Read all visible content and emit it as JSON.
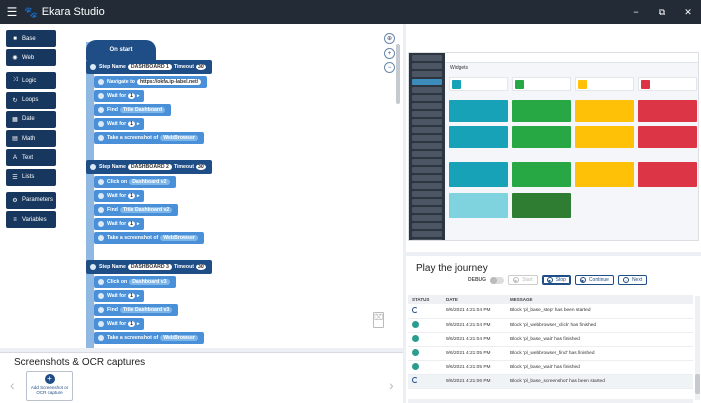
{
  "app": {
    "title": "Ekara Studio",
    "menu_icon": "hamburger-icon",
    "logo_icon": "paw-icon",
    "window_controls": [
      "−",
      "⧉",
      "✕"
    ]
  },
  "palette": {
    "items": [
      {
        "label": "Base",
        "icon": "briefcase-icon",
        "glyph": "■"
      },
      {
        "label": "Web",
        "icon": "globe-icon",
        "glyph": "◉"
      },
      {
        "label": "Logic",
        "icon": "shuffle-icon",
        "glyph": "⤨"
      },
      {
        "label": "Loops",
        "icon": "loop-icon",
        "glyph": "↻"
      },
      {
        "label": "Date",
        "icon": "calendar-icon",
        "glyph": "▦"
      },
      {
        "label": "Math",
        "icon": "calculator-icon",
        "glyph": "▤"
      },
      {
        "label": "Text",
        "icon": "text-icon",
        "glyph": "A"
      },
      {
        "label": "Lists",
        "icon": "list-icon",
        "glyph": "☰"
      },
      {
        "label": "Parameters",
        "icon": "sliders-icon",
        "glyph": "⚙"
      },
      {
        "label": "Variables",
        "icon": "variables-icon",
        "glyph": "≡"
      }
    ]
  },
  "blocks": {
    "on_start": "On start",
    "steps": [
      {
        "step": "Step",
        "name_label": "Name",
        "name": "DASHBOARD 1",
        "timeout_label": "Timeout",
        "timeout": "30",
        "subs": [
          {
            "pre": "Navigate to",
            "val": "https://okfa.ip-label.net/"
          },
          {
            "pre": "Wait for",
            "val": "1"
          },
          {
            "pre": "Find",
            "val": "Title Dashboard"
          },
          {
            "pre": "Wait for",
            "val": "1"
          },
          {
            "pre": "Take a screenshot of",
            "val": "WebBrowser"
          }
        ]
      },
      {
        "step": "Step",
        "name_label": "Name",
        "name": "DASHBOARD 2",
        "timeout_label": "Timeout",
        "timeout": "30",
        "subs": [
          {
            "pre": "Click on",
            "val": "Dashboard v2"
          },
          {
            "pre": "Wait for",
            "val": "1"
          },
          {
            "pre": "Find",
            "val": "Title Dashboard v2"
          },
          {
            "pre": "Wait for",
            "val": "1"
          },
          {
            "pre": "Take a screenshot of",
            "val": "WebBrowser"
          }
        ]
      },
      {
        "step": "Step",
        "name_label": "Name",
        "name": "DASHBOARD 3",
        "timeout_label": "Timeout",
        "timeout": "30",
        "subs": [
          {
            "pre": "Click on",
            "val": "Dashboard v3"
          },
          {
            "pre": "Wait for",
            "val": "1"
          },
          {
            "pre": "Find",
            "val": "Title Dashboard v3"
          },
          {
            "pre": "Wait for",
            "val": "1"
          },
          {
            "pre": "Take a screenshot of",
            "val": "WebBrowser"
          }
        ]
      }
    ]
  },
  "screenshots": {
    "title": "Screenshots & OCR captures",
    "add_label": "Add Screenshot or OCR capture"
  },
  "preview": {
    "page_title": "Widgets"
  },
  "journey": {
    "title": "Play the journey",
    "debug_label": "DEBUG",
    "buttons": {
      "start": "Start",
      "stop": "Stop",
      "continue": "Continue",
      "next": "Next"
    },
    "columns": {
      "status": "STATUS",
      "date": "DATE",
      "message": "MESSAGE"
    },
    "rows": [
      {
        "status": "running",
        "date": "9/6/2021 4:21:04 PM",
        "message": "Block 'pl_base_step' has been started"
      },
      {
        "status": "done",
        "date": "9/6/2021 4:21:04 PM",
        "message": "Block 'pl_webbrowser_click' has finished"
      },
      {
        "status": "done",
        "date": "9/6/2021 4:21:04 PM",
        "message": "Block 'pl_base_wait' has finished"
      },
      {
        "status": "done",
        "date": "9/6/2021 4:21:05 PM",
        "message": "Block 'pl_webbrowser_find' has finished"
      },
      {
        "status": "done",
        "date": "9/6/2021 4:21:05 PM",
        "message": "Block 'pl_base_wait' has finished"
      },
      {
        "status": "running",
        "date": "9/6/2021 4:21:06 PM",
        "message": "Block 'pl_base_screenshot' has been started"
      }
    ]
  },
  "colors": {
    "titlebar": "#222b36",
    "category": "#17375e",
    "step": "#1f4d86",
    "sub": "#4a90d9"
  }
}
